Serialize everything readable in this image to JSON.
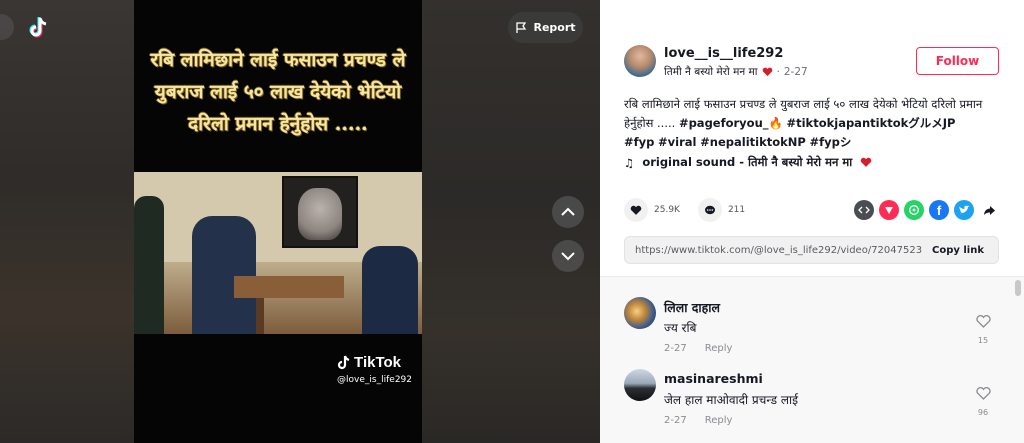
{
  "video": {
    "caption": "रबि लामिछाने लाई फसाउन प्रचण्ड ले युबराज लाई ५० लाख देयेको भेटियो दरिलो प्रमान हेर्नुहोस .....",
    "watermark_brand": "TikTok",
    "watermark_handle": "@love_is_life292",
    "report_label": "Report"
  },
  "post": {
    "username": "love__is__life292",
    "nickname": "तिमी नै बस्यो मेरो मन मा",
    "date": "2-27",
    "follow_label": "Follow",
    "description_text": "रबि लामिछाने लाई फसाउन प्रचण्ड ले युबराज लाई ५० लाख देयेको भेटियो दरिलो प्रमान हेर्नुहोस .....",
    "hashtags_line1": [
      "#pageforyou_🔥",
      "#tiktokjapantiktokグルメJP"
    ],
    "hashtags_line2": [
      "#fyp",
      "#viral",
      "#nepalitiktokNP",
      "#fypシ"
    ],
    "sound_prefix": "original sound - ",
    "sound_title": "तिमी नै बस्यो मेरो मन मा",
    "likes": "25.9K",
    "comments": "211",
    "link_url": "https://www.tiktok.com/@love_is_life292/video/72047523...",
    "copy_link_label": "Copy link"
  },
  "comments": [
    {
      "name": "लिला दाहाल",
      "text": "ज्य रबि",
      "date": "2-27",
      "reply": "Reply",
      "likes": "15"
    },
    {
      "name": "masinareshmi",
      "text": "जेल हाल माओवादी प्रचन्ड लाई",
      "date": "2-27",
      "reply": "Reply",
      "likes": "96"
    }
  ],
  "colors": {
    "accent": "#fe2c55",
    "text": "#161823",
    "muted": "#8a8b91"
  }
}
